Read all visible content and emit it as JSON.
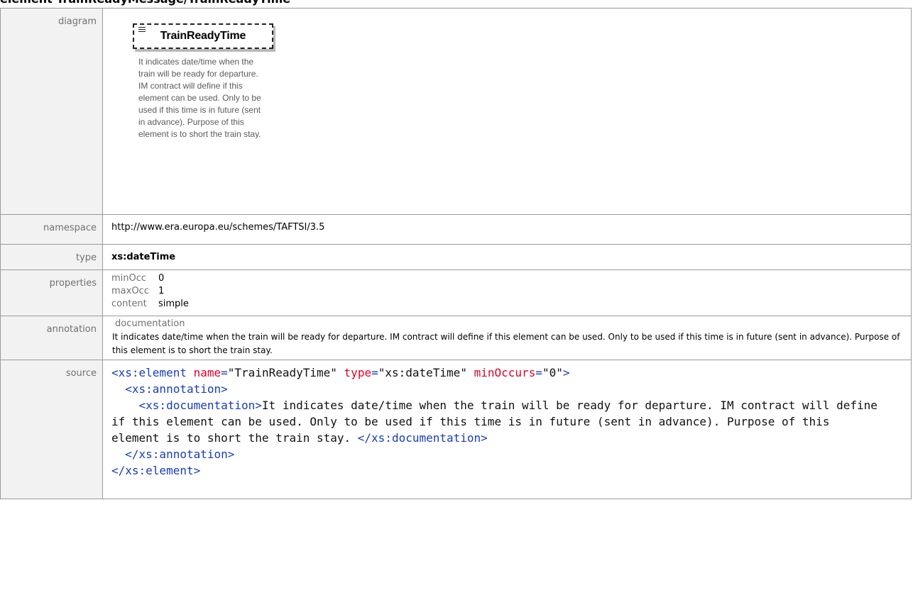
{
  "page": {
    "title": "element TrainReadyMessage/TrainReadyTime"
  },
  "labels": {
    "diagram": "diagram",
    "namespace": "namespace",
    "type": "type",
    "properties": "properties",
    "annotation": "annotation",
    "source": "source"
  },
  "diagram": {
    "element_name": "TrainReadyTime",
    "element_doc": "It indicates date/time when the train will be ready for departure. IM contract will define if this element can be used. Only to be used if this time is in future (sent in advance). Purpose of this element is to short the train stay."
  },
  "namespace": "http://www.era.europa.eu/schemes/TAFTSI/3.5",
  "type": "xs:dateTime",
  "properties": [
    {
      "key": "minOcc",
      "value": "0"
    },
    {
      "key": "maxOcc",
      "value": "1"
    },
    {
      "key": "content",
      "value": "simple"
    }
  ],
  "annotation": {
    "title": "documentation",
    "text": "It indicates date/time when the train will be ready for departure. IM contract will define if this element can be used. Only to be used if this time is in future (sent in advance). Purpose of this element is to short the train stay."
  },
  "source": {
    "open_tag": "<xs:element",
    "attr_name": "name",
    "attr_name_val": "\"TrainReadyTime\"",
    "attr_type": "type",
    "attr_type_val": "\"xs:dateTime\"",
    "attr_min": "minOccurs",
    "attr_min_val": "\"0\"",
    "close_bracket": ">",
    "ann_open": "<xs:annotation>",
    "doc_open": "<xs:documentation>",
    "doc_text": "It indicates date/time when the train will be ready for departure. IM contract will define if this element can be used. Only to be used if this time is in future (sent in advance). Purpose of this element is to short the train stay. ",
    "doc_close": "</xs:documentation>",
    "ann_close": "</xs:annotation>",
    "elem_close": "</xs:element>"
  }
}
